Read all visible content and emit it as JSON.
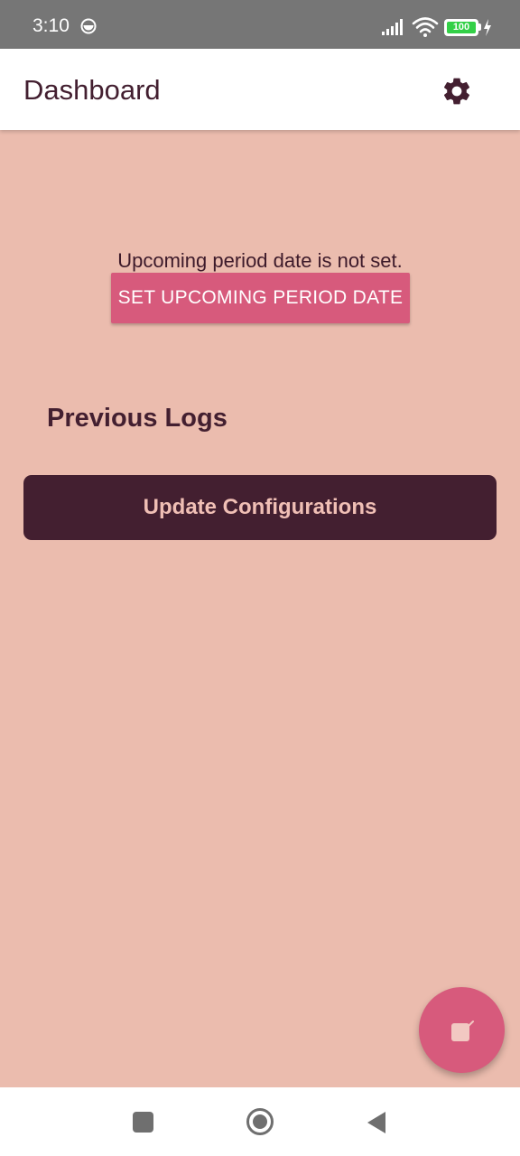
{
  "status_bar": {
    "time": "3:10",
    "battery_level": "100",
    "icons": [
      "app-notification-icon",
      "signal-icon",
      "wifi-icon",
      "battery-icon",
      "charging-icon"
    ]
  },
  "app_bar": {
    "title": "Dashboard",
    "settings_icon": "gear-icon"
  },
  "main": {
    "period_status_text": "Upcoming period date is not set.",
    "set_period_button_label": "SET UPCOMING PERIOD DATE",
    "previous_logs_title": "Previous Logs",
    "update_config_button_label": "Update Configurations"
  },
  "fab": {
    "icon": "edit-icon"
  },
  "nav_bar": {
    "icons": [
      "recents-icon",
      "home-icon",
      "back-icon"
    ]
  },
  "colors": {
    "background": "#ebbcae",
    "primary_dark": "#431f30",
    "accent": "#d75a7c",
    "app_bar": "#ffffff",
    "status_bar": "#767676"
  }
}
